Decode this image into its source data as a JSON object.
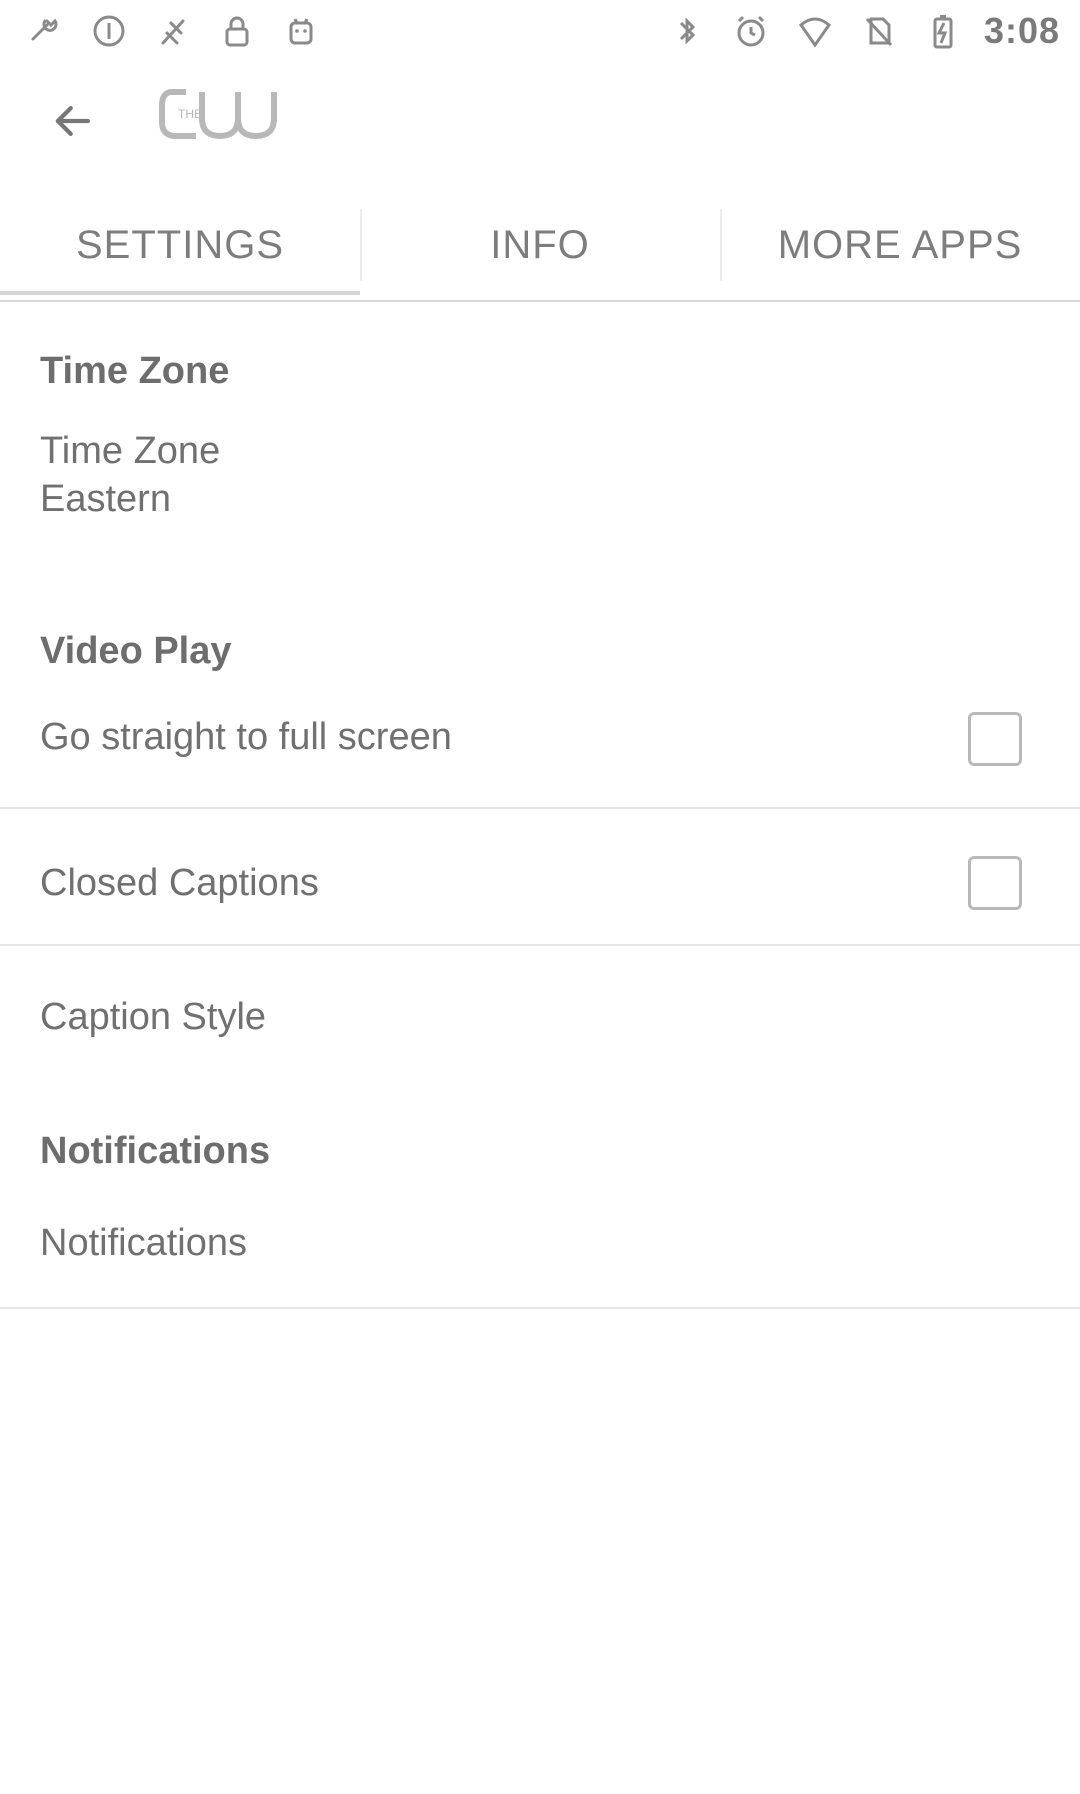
{
  "status_bar": {
    "time": "3:08",
    "left_icons": [
      "wrench-icon",
      "power-circle-icon",
      "fast-icon",
      "lock-icon",
      "android-icon"
    ],
    "right_icons": [
      "bluetooth-icon",
      "alarm-icon",
      "wifi-icon",
      "no-sim-icon",
      "battery-charging-icon"
    ]
  },
  "app_bar": {
    "back_icon": "arrow-back-icon",
    "logo_text": "CW",
    "logo_prefix": "THE"
  },
  "tabs": [
    {
      "label": "SETTINGS"
    },
    {
      "label": "INFO"
    },
    {
      "label": "MORE APPS"
    }
  ],
  "settings": {
    "time_zone_header": "Time Zone",
    "time_zone_title": "Time Zone",
    "time_zone_value": "Eastern",
    "video_play_header": "Video Play",
    "full_screen_label": "Go straight to full screen",
    "closed_captions_label": "Closed Captions",
    "caption_style_label": "Caption Style",
    "notifications_header": "Notifications",
    "notifications_label": "Notifications"
  }
}
